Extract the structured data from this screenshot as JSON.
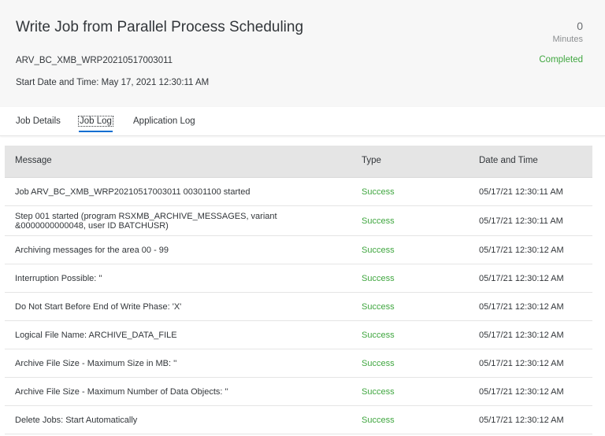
{
  "header": {
    "title": "Write Job from Parallel Process Scheduling",
    "job_name": "ARV_BC_XMB_WRP20210517003011",
    "start_date": "Start Date and Time: May 17, 2021 12:30:11 AM",
    "duration_value": "0",
    "duration_unit": "Minutes",
    "status": "Completed"
  },
  "tabs": [
    {
      "label": "Job Details"
    },
    {
      "label": "Job Log",
      "selected": true
    },
    {
      "label": "Application Log"
    }
  ],
  "table": {
    "columns": [
      "Message",
      "Type",
      "Date and Time"
    ],
    "rows": [
      {
        "message": "Job ARV_BC_XMB_WRP20210517003011 00301100 started",
        "type": "Success",
        "datetime": "05/17/21 12:30:11 AM"
      },
      {
        "message": "Step 001 started (program RSXMB_ARCHIVE_MESSAGES, variant &0000000000048, user ID BATCHUSR)",
        "type": "Success",
        "datetime": "05/17/21 12:30:11 AM"
      },
      {
        "message": "Archiving messages for the area 00 - 99",
        "type": "Success",
        "datetime": "05/17/21 12:30:12 AM"
      },
      {
        "message": "Interruption Possible: ''",
        "type": "Success",
        "datetime": "05/17/21 12:30:12 AM"
      },
      {
        "message": "Do Not Start Before End of Write Phase: 'X'",
        "type": "Success",
        "datetime": "05/17/21 12:30:12 AM"
      },
      {
        "message": "Logical File Name: ARCHIVE_DATA_FILE",
        "type": "Success",
        "datetime": "05/17/21 12:30:12 AM"
      },
      {
        "message": "Archive File Size - Maximum Size in MB: ''",
        "type": "Success",
        "datetime": "05/17/21 12:30:12 AM"
      },
      {
        "message": "Archive File Size - Maximum Number of Data Objects: ''",
        "type": "Success",
        "datetime": "05/17/21 12:30:12 AM"
      },
      {
        "message": "Delete Jobs: Start Automatically",
        "type": "Success",
        "datetime": "05/17/21 12:30:12 AM"
      }
    ]
  },
  "colors": {
    "success": "#3fa63f",
    "tab_underline": "#0a6ed1",
    "header_bg": "#f7f7f7",
    "table_header_bg": "#e5e5e5"
  }
}
